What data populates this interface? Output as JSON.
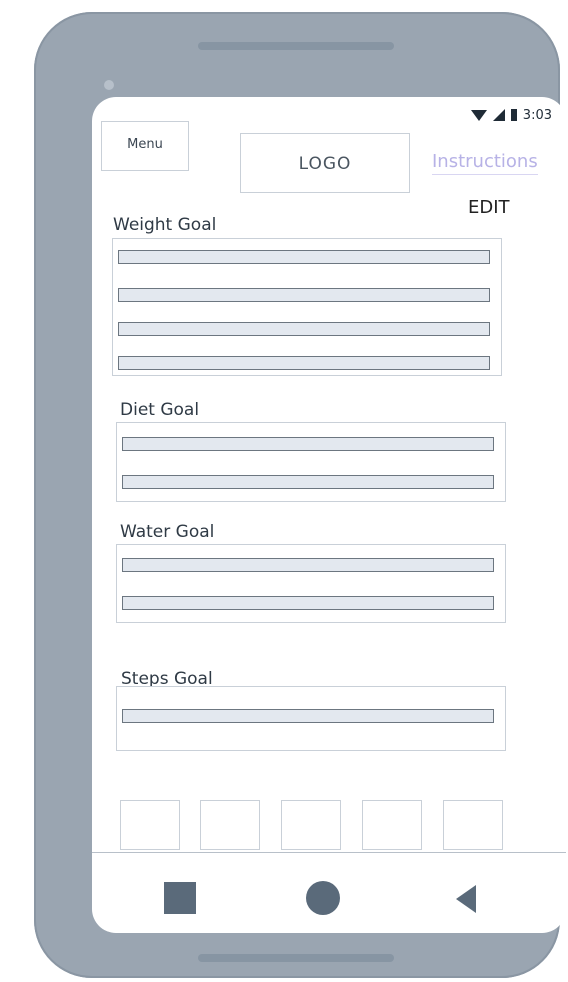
{
  "status": {
    "time": "3:03"
  },
  "header": {
    "menu_label": "Menu",
    "logo_label": "LOGO",
    "instructions_label": "Instructions",
    "edit_label": "EDIT"
  },
  "sections": {
    "weight": {
      "label": "Weight Goal"
    },
    "diet": {
      "label": "Diet Goal"
    },
    "water": {
      "label": "Water Goal"
    },
    "steps": {
      "label": "Steps Goal"
    }
  },
  "icons": {
    "wifi": "wifi-icon",
    "signal": "signal-icon",
    "battery": "battery-icon",
    "home": "circle-icon",
    "recents": "square-icon",
    "back": "back-triangle-icon"
  },
  "colors": {
    "phone_frame": "#9aa5b1",
    "instructions_link": "#b7b2e6",
    "field_fill": "#e3e8ef",
    "nav_icons": "#5a6a7a"
  }
}
